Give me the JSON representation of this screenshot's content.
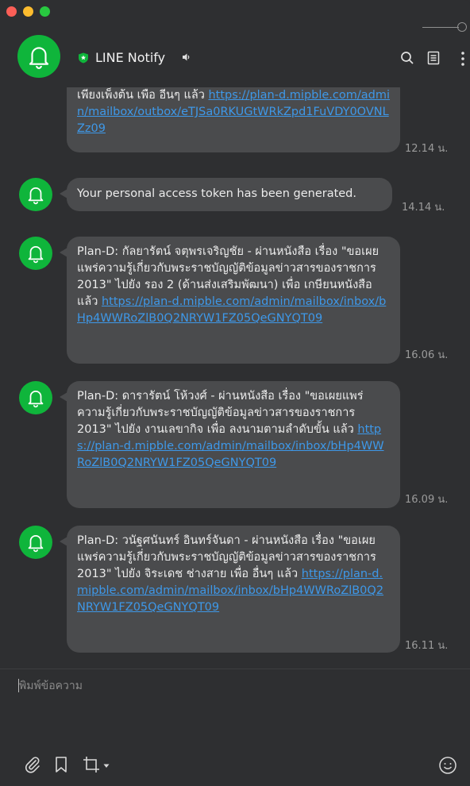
{
  "app": {
    "title": "LINE Notify"
  },
  "messages": [
    {
      "text": "เพียงเพ็งต้น เพือ อีนๆ แล้ว",
      "link": "https://plan-d.mipble.com/admin/mailbox/outbox/eTJSa0RKUGtWRkZpd1FuVDY0OVNLZz09",
      "time": "12.14 น."
    },
    {
      "text": "Your personal access token has been generated.",
      "time": "14.14 น."
    },
    {
      "text": "Plan-D: กัลยารัตน์ จตุพรเจริญชัย - ผ่านหนังสือ เรื่อง \"ขอเผยแพร่ความรู้เกี่ยวกับพระราชบัญญัติข้อมูลข่าวสารของราชการ 2013\" ไปยัง รอง 2 (ด้านส่งเสริมพัฒนา) เพื่อ เกษียนหนังสือ แล้ว",
      "link": "https://plan-d.mipble.com/admin/mailbox/inbox/bHp4WWRoZlB0Q2NRYW1FZ05QeGNYQT09",
      "time": "16.06 น."
    },
    {
      "text": "Plan-D: ดารารัตน์ โห้วงศ์ - ผ่านหนังสือ เรื่อง \"ขอเผยแพร่ความรู้เกี่ยวกับพระราชบัญญัติข้อมูลข่าวสารของราชการ 2013\" ไปยัง งานเลขากิจ เพื่อ ลงนามตามลำดับขั้น แล้ว",
      "link": "https://plan-d.mipble.com/admin/mailbox/inbox/bHp4WWRoZlB0Q2NRYW1FZ05QeGNYQT09",
      "time": "16.09 น."
    },
    {
      "text": "Plan-D: วนัฐศนันทร์ อินทร์จันดา - ผ่านหนังสือ เรื่อง \"ขอเผยแพร่ความรู้เกี่ยวกับพระราชบัญญัติข้อมูลข่าวสารของราชการ 2013\" ไปยัง จิระเดช ช่างสาย เพื่อ อื่นๆ แล้ว",
      "link": "https://plan-d.mipble.com/admin/mailbox/inbox/bHp4WWRoZlB0Q2NRYW1FZ05QeGNYQT09",
      "time": "16.11 น."
    }
  ],
  "input": {
    "placeholder": "พิมพ์ข้อความ"
  },
  "icons": {
    "avatar": "bell-icon",
    "official": "shield-icon",
    "mute": "speaker-icon",
    "search": "search-icon",
    "notes": "notes-icon",
    "more": "more-icon",
    "attach": "paperclip-icon",
    "keep": "bookmark-icon",
    "capture": "crop-icon",
    "emoji": "emoji-icon"
  },
  "colors": {
    "accent": "#0fb53b",
    "bubble": "#4a4b4d",
    "link": "#3e98e8",
    "background": "#2e2f31"
  }
}
